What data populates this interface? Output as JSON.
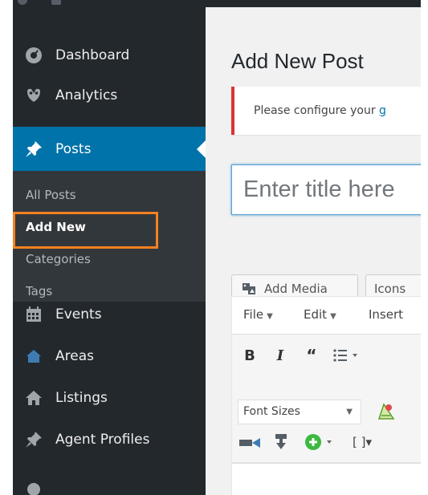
{
  "sidebar": {
    "items": [
      {
        "label": "Dashboard",
        "icon": "dashboard-icon"
      },
      {
        "label": "Analytics",
        "icon": "analytics-icon"
      },
      {
        "label": "Posts",
        "icon": "pin-icon"
      },
      {
        "label": "Events",
        "icon": "calendar-icon"
      },
      {
        "label": "Areas",
        "icon": "house-icon"
      },
      {
        "label": "Listings",
        "icon": "home-icon"
      },
      {
        "label": "Agent Profiles",
        "icon": "pin-icon"
      }
    ],
    "submenu": [
      {
        "label": "All Posts"
      },
      {
        "label": "Add New"
      },
      {
        "label": "Categories"
      },
      {
        "label": "Tags"
      }
    ]
  },
  "main": {
    "page_title": "Add New Post",
    "notice_text": "Please configure your",
    "notice_link": "g",
    "title_placeholder": "Enter title here",
    "add_media_label": "Add Media",
    "icons_label": "Icons",
    "menubar": [
      "File",
      "Edit",
      "Insert"
    ],
    "font_sizes_label": "Font Sizes"
  },
  "colors": {
    "sidebar_bg": "#23282d",
    "submenu_bg": "#32373c",
    "accent": "#0073aa",
    "highlight_box": "#f48120",
    "notice_border": "#dc3232"
  }
}
